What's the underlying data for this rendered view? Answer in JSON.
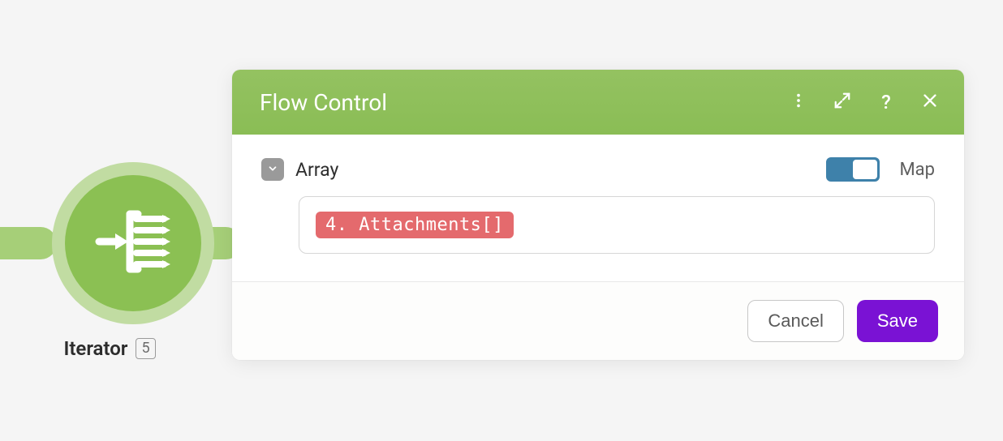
{
  "node": {
    "label": "Iterator",
    "badge": "5"
  },
  "panel": {
    "title": "Flow Control",
    "field_label": "Array",
    "map_label": "Map",
    "map_on": true,
    "pill": "4. Attachments[]",
    "cancel": "Cancel",
    "save": "Save"
  }
}
